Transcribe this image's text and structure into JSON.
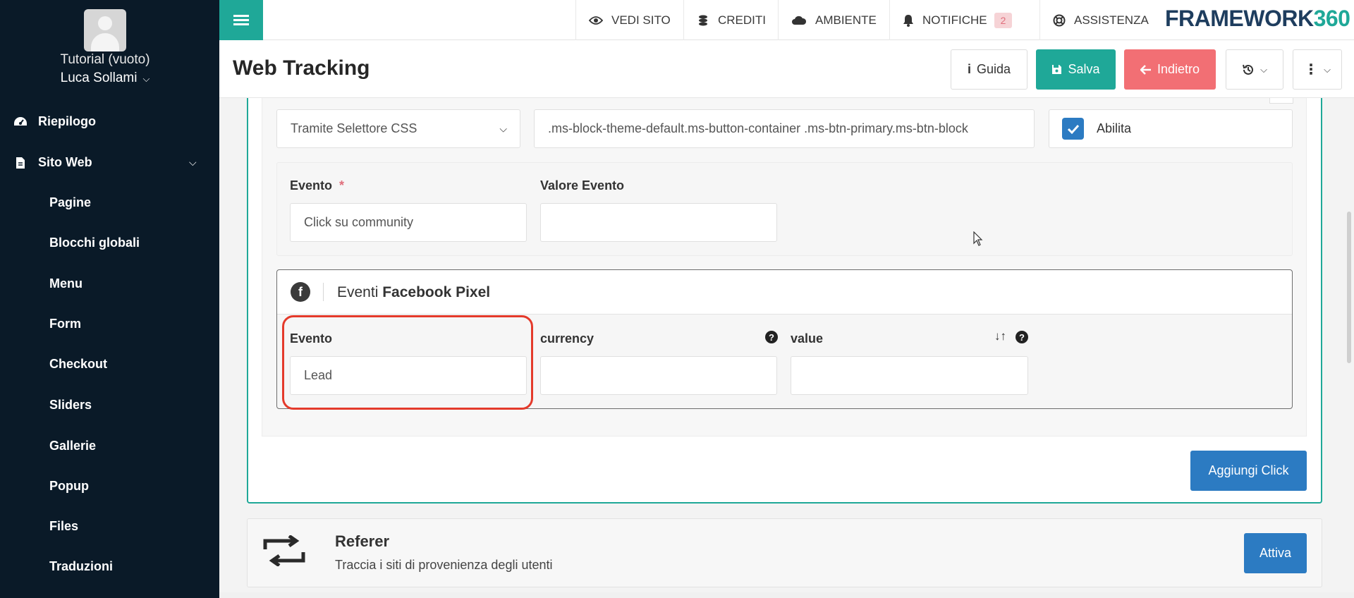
{
  "sidebar": {
    "site_name": "Tutorial (vuoto)",
    "user_name": "Luca Sollami",
    "top_items": [
      {
        "label": "Riepilogo",
        "icon": "dashboard-icon"
      },
      {
        "label": "Sito Web",
        "icon": "file-icon"
      }
    ],
    "sub_items": [
      "Pagine",
      "Blocchi globali",
      "Menu",
      "Form",
      "Checkout",
      "Sliders",
      "Gallerie",
      "Popup",
      "Files",
      "Traduzioni"
    ]
  },
  "topbar": {
    "items": [
      {
        "label": "VEDI SITO",
        "icon": "eye-icon"
      },
      {
        "label": "CREDITI",
        "icon": "coins-icon"
      },
      {
        "label": "AMBIENTE",
        "icon": "cloud-icon"
      },
      {
        "label": "NOTIFICHE",
        "icon": "bell-icon"
      },
      {
        "label": "ASSISTENZA",
        "icon": "lifebuoy-icon"
      }
    ],
    "notifications_count": "2",
    "brand_text": "FRAMEWORK",
    "brand_num": "360"
  },
  "header": {
    "title": "Web Tracking",
    "guida_label": "Guida",
    "salva_label": "Salva",
    "indietro_label": "Indietro"
  },
  "click_config": {
    "selector_type": "Tramite Selettore CSS",
    "css_selector": ".ms-block-theme-default.ms-button-container .ms-btn-primary.ms-btn-block",
    "enable_label": "Abilita",
    "enable_checked": true
  },
  "event_section": {
    "event_label": "Evento",
    "required_mark": "*",
    "event_value": "Click su community",
    "event_value_label": "Valore Evento",
    "event_value_value": ""
  },
  "facebook_pixel": {
    "title_prefix": "Eventi",
    "title_bold": "Facebook Pixel",
    "event_label": "Evento",
    "event_value": "Lead",
    "currency_label": "currency",
    "currency_value": "",
    "value_label": "value",
    "value_value": ""
  },
  "buttons": {
    "add_click": "Aggiungi Click",
    "attiva": "Attiva"
  },
  "referer": {
    "title": "Referer",
    "description": "Traccia i siti di provenienza degli utenti"
  },
  "colors": {
    "accent": "#1fa898",
    "danger": "#f26f74",
    "primary": "#2c7bc2",
    "sidebar": "#0a1a28",
    "highlight": "#e43a2b"
  }
}
